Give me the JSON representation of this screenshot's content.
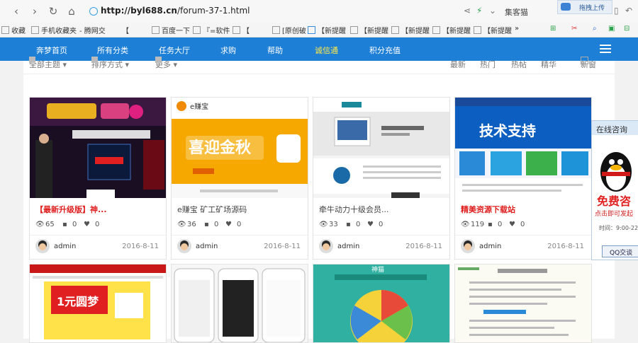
{
  "browser": {
    "url_host": "http://byl688.cn",
    "url_path": "/forum-37-1.html",
    "search_label": "集客猫",
    "upload_label": "拖拽上传",
    "nav_glyphs": {
      "back": "‹",
      "forward": "›",
      "reload": "↻",
      "home": "⌂"
    },
    "right_glyphs": {
      "share": "⋖",
      "flash": "⚡",
      "dropdown": "⌄",
      "phone": "▯",
      "undo": "↶",
      "menu": "≡"
    }
  },
  "bookmarks": [
    "收藏",
    "手机收藏夹",
    "- 腾网交",
    "【",
    "百度一下",
    "『=软件",
    "【",
    "[原创破",
    "【新提醒",
    "【新提醒",
    "【新提醒",
    "【新提醒",
    "【新提醒",
    "»"
  ],
  "nav": {
    "items": [
      "奔梦首页",
      "所有分类",
      "任务大厅",
      "求购",
      "帮助",
      "诚信通",
      "积分充值"
    ],
    "active_index": 5,
    "bg_color": "#1e7fd6",
    "active_color": "#ffe94a"
  },
  "filter": {
    "left": [
      "全部主题",
      "排序方式",
      "更多"
    ],
    "right": [
      "最新",
      "热门",
      "热帖",
      "精华",
      "新窗"
    ]
  },
  "cards": [
    {
      "title": "【最新升级版】神...",
      "title_style": "red",
      "views": "65",
      "comments": "0",
      "likes": "0",
      "author": "admin",
      "date": "2016-8-11",
      "thumb": "stage"
    },
    {
      "title": "e赚宝 矿工矿场源码",
      "title_style": "gray",
      "views": "36",
      "comments": "0",
      "likes": "0",
      "author": "admin",
      "date": "2016-8-11",
      "thumb": "orange"
    },
    {
      "title": "牵牛动力十级会员...",
      "title_style": "gray",
      "views": "33",
      "comments": "0",
      "likes": "0",
      "author": "admin",
      "date": "2016-8-11",
      "thumb": "web"
    },
    {
      "title": "精美资源下载站",
      "title_style": "red",
      "views": "119",
      "comments": "0",
      "likes": "0",
      "author": "admin",
      "date": "2016-8-11",
      "thumb": "support"
    }
  ],
  "thumb_text": {
    "ezb_logo": "e赚宝",
    "ezb_banner": "喜迎金秋",
    "support_banner": "技术支持",
    "yuan_banner": "1元圆梦",
    "shenmao": "神猫"
  },
  "float_panel": {
    "header": "在线咨询",
    "big_text": "免费咨",
    "sub_text": "点击即可发起",
    "time_text": "时间：9:00-22",
    "button": "QQ交谈"
  }
}
